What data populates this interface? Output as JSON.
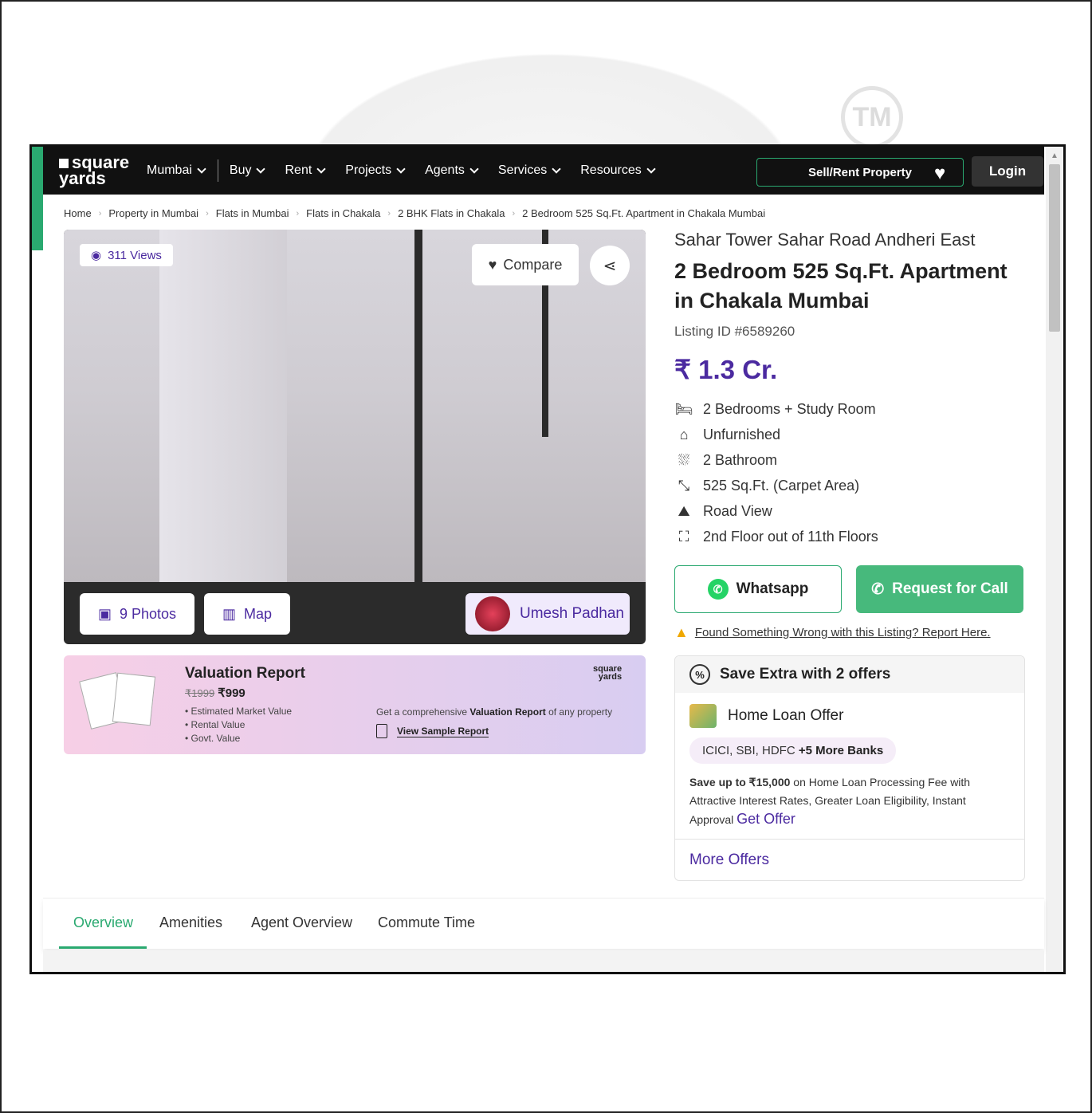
{
  "watermark": {
    "tm": "TM"
  },
  "nav": {
    "logo_line1": "square",
    "logo_line2": "yards",
    "city": "Mumbai",
    "items": [
      "Buy",
      "Rent",
      "Projects",
      "Agents",
      "Services",
      "Resources"
    ],
    "sell_label": "Sell/Rent Property",
    "login": "Login"
  },
  "breadcrumb": [
    "Home",
    "Property in Mumbai",
    "Flats in Mumbai",
    "Flats in Chakala",
    "2 BHK Flats in Chakala",
    "2 Bedroom 525 Sq.Ft. Apartment in Chakala Mumbai"
  ],
  "gallery": {
    "views": "311 Views",
    "compare": "Compare",
    "photos": "9 Photos",
    "map": "Map",
    "agent": "Umesh Padhan"
  },
  "valuation": {
    "title": "Valuation Report",
    "old_price": "₹1999",
    "price": "₹999",
    "points": [
      "Estimated Market Value",
      "Rental Value",
      "Govt. Value"
    ],
    "brand_line1": "square",
    "brand_line2": "yards",
    "desc_pre": "Get a comprehensive ",
    "desc_bold": "Valuation Report",
    "desc_post": " of any property",
    "sample": "View Sample Report"
  },
  "property": {
    "location": "Sahar Tower Sahar Road Andheri East",
    "title": "2 Bedroom 525 Sq.Ft. Apartment in Chakala Mumbai",
    "listing_id": "Listing ID #6589260",
    "price": "₹ 1.3 Cr.",
    "specs": [
      {
        "icon": "bed-icon",
        "text": "2 Bedrooms + Study Room"
      },
      {
        "icon": "sofa-icon",
        "text": "Unfurnished"
      },
      {
        "icon": "bathtub-icon",
        "text": "2 Bathroom"
      },
      {
        "icon": "area-icon",
        "text": "525 Sq.Ft. (Carpet Area)"
      },
      {
        "icon": "view-icon",
        "text": "Road View"
      },
      {
        "icon": "floor-icon",
        "text": "2nd Floor out of 11th Floors"
      }
    ],
    "whatsapp": "Whatsapp",
    "call": "Request for Call",
    "report": "Found Something Wrong with this Listing? Report Here."
  },
  "offers": {
    "header": "Save Extra with 2 offers",
    "loan_title": "Home Loan Offer",
    "banks": "ICICI, SBI, HDFC",
    "banks_more": "+5 More Banks",
    "desc_bold": "Save up to ₹15,000",
    "desc": " on Home Loan Processing Fee with Attractive Interest Rates, Greater Loan Eligibility, Instant Approval ",
    "get_offer": "Get Offer",
    "more": "More Offers"
  },
  "tabs": [
    "Overview",
    "Amenities",
    "Agent Overview",
    "Commute Time"
  ],
  "colors": {
    "brand_green": "#2aa970",
    "brand_purple": "#4b2aa0"
  }
}
